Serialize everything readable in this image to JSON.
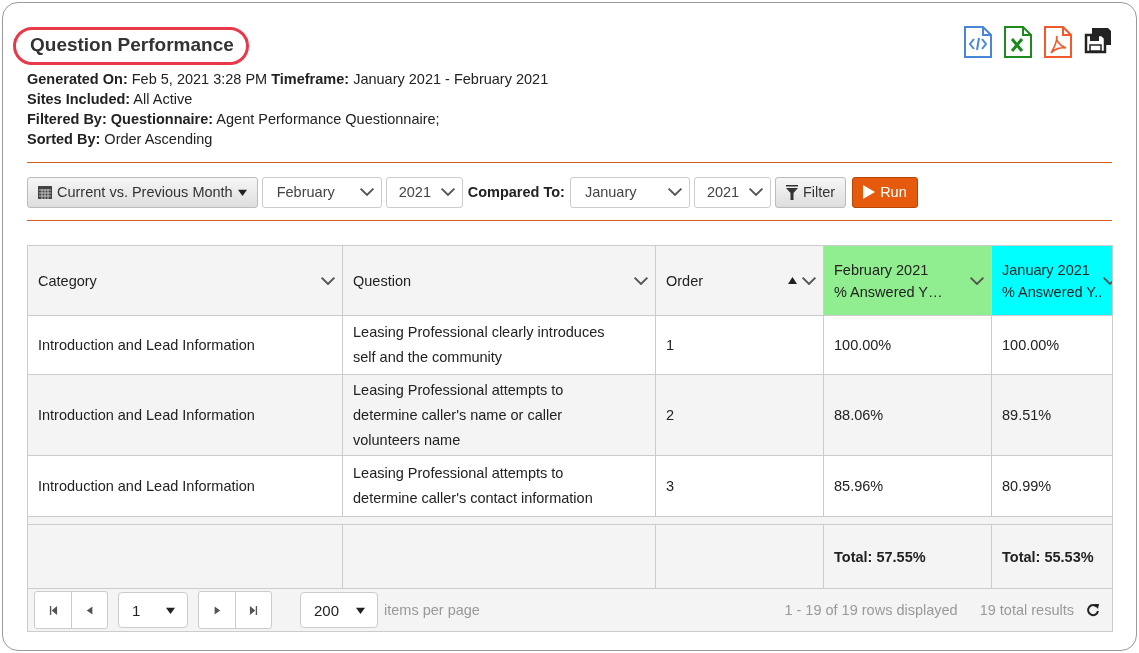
{
  "report": {
    "title": "Question Performance",
    "meta": [
      "**Generated On:** Feb 5, 2021 3:28 PM **Timeframe:** January 2021 - February 2021",
      "**Sites Included:** All Active",
      "**Filtered By: Questionnaire:** Agent Performance Questionnaire;",
      "**Sorted By:** Order Ascending"
    ]
  },
  "export_icons": [
    {
      "kind": "code"
    },
    {
      "kind": "excel"
    },
    {
      "kind": "pdf"
    },
    {
      "kind": "save"
    }
  ],
  "toolbar": {
    "range_button": "Current vs. Previous Month",
    "month": "February",
    "year": "2021",
    "compared_label": "Compared To:",
    "compare_month": "January",
    "compare_year": "2021",
    "filter_button": "Filter",
    "run_button": "Run"
  },
  "table": {
    "columns": [
      {
        "lines": [
          "Category"
        ],
        "sorted": false
      },
      {
        "lines": [
          "Question"
        ],
        "sorted": false
      },
      {
        "lines": [
          "Order"
        ],
        "sorted": true
      },
      {
        "lines": [
          "February 2021",
          "% Answered Y…"
        ],
        "sorted": false,
        "color": "#90ee90"
      },
      {
        "lines": [
          "January 2021",
          "% Answered Y.."
        ],
        "sorted": false,
        "color": "#00ffff"
      }
    ],
    "rows": [
      [
        "Introduction and Lead Information",
        "Leasing Professional clearly introduces self and the community",
        "1",
        "100.00%",
        "100.00%"
      ],
      [
        "Introduction and Lead Information",
        "Leasing Professional attempts to determine caller's name or caller volunteers name",
        "2",
        "88.06%",
        "89.51%"
      ],
      [
        "Introduction and Lead Information",
        "Leasing Professional attempts to determine caller's contact information",
        "3",
        "85.96%",
        "80.99%"
      ]
    ],
    "totals": [
      "Total: 57.55%",
      "Total: 55.53%"
    ]
  },
  "pager": {
    "page": "1",
    "page_size": "200",
    "page_size_label": "items per page",
    "rows_info": "1 - 19 of 19 rows displayed",
    "total_info": "19 total results"
  }
}
